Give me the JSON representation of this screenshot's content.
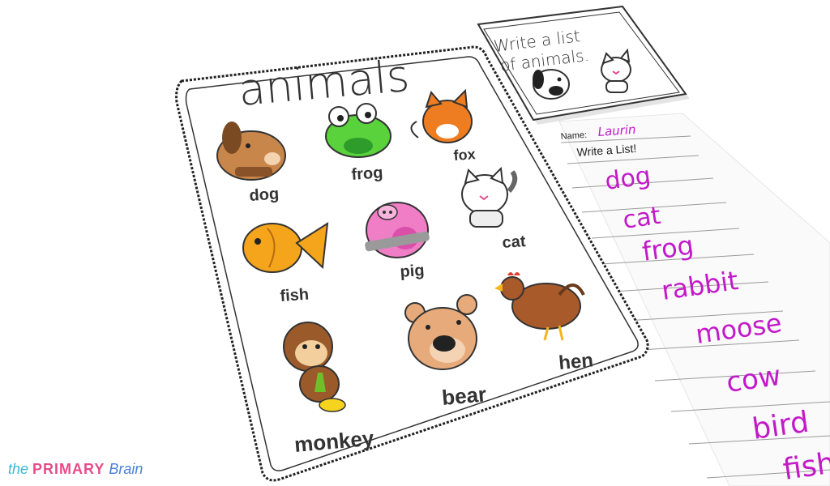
{
  "card": {
    "title": "animals",
    "labels": {
      "dog": "dog",
      "frog": "frog",
      "fox": "fox",
      "fish": "fish",
      "pig": "pig",
      "cat": "cat",
      "monkey": "monkey",
      "bear": "bear",
      "hen": "hen"
    }
  },
  "prompt_card": {
    "line1": "Write a list",
    "line2": "of animals."
  },
  "worksheet": {
    "name_label": "Name:",
    "name_value": "Laurin",
    "heading": "Write a List!",
    "entries": [
      "dog",
      "cat",
      "frog",
      "rabbit",
      "moose",
      "cow",
      "bird",
      "fish"
    ]
  },
  "brand": {
    "part1": "the",
    "part2": "PRIMARY",
    "part3": "Brain"
  },
  "colors": {
    "handwriting": "#c21ac9",
    "brand_blue": "#39b7d5",
    "brand_pink": "#e84a8a"
  }
}
